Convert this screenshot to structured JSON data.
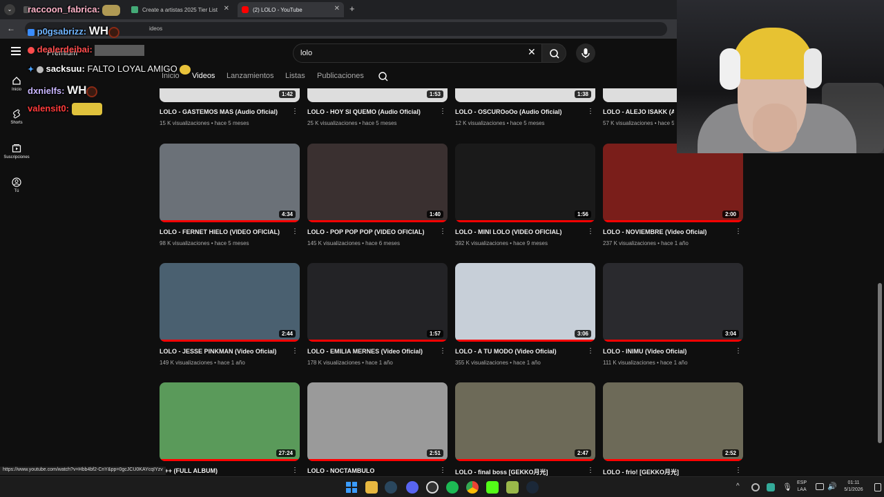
{
  "browser": {
    "tabs": [
      {
        "label": "",
        "color": "#555"
      },
      {
        "label": "Create a artistas 2025 Tier List",
        "color": "#4a7"
      },
      {
        "label": "(2) LOLO - YouTube",
        "color": "#f00"
      }
    ],
    "url_fragment": "ideos",
    "status_url": "https://www.youtube.com/watch?v=Hbb4bf2-CnY&pp=0gcJCU0KAYcqIYzv"
  },
  "youtube": {
    "search_value": "lolo",
    "premium_label": "Premium",
    "sidebar": [
      {
        "label": "Inicio"
      },
      {
        "label": "Shorts"
      },
      {
        "label": "Suscripciones"
      },
      {
        "label": "Tú"
      }
    ],
    "channel_tabs": [
      "Inicio",
      "Videos",
      "Lanzamientos",
      "Listas",
      "Publicaciones"
    ],
    "rows": [
      [
        {
          "title": "LOLO - GASTEMOS MAS (Audio Oficial)",
          "meta": "15 K visualizaciones • hace 5 meses",
          "dur": "1:42",
          "color": "#ddd"
        },
        {
          "title": "LOLO - HOY SI QUEMO (Audio Oficial)",
          "meta": "25 K visualizaciones • hace 5 meses",
          "dur": "1:53",
          "color": "#ddd"
        },
        {
          "title": "LOLO - OSCUROoOo (Audio Oficial)",
          "meta": "12 K visualizaciones • hace 5 meses",
          "dur": "1:38",
          "color": "#ddd"
        },
        {
          "title": "LOLO - ALEJO ISAKK (Au",
          "meta": "57 K visualizaciones • hace 5",
          "dur": "",
          "color": "#ddd"
        }
      ],
      [
        {
          "title": "LOLO - FERNET HIELO (VIDEO OFICIAL)",
          "meta": "98 K visualizaciones • hace 5 meses",
          "dur": "4:34",
          "color": "#6b7178"
        },
        {
          "title": "LOLO - POP POP POP (VIDEO OFICIAL)",
          "meta": "145 K visualizaciones • hace 6 meses",
          "dur": "1:40",
          "color": "#3a3030"
        },
        {
          "title": "LOLO - MINI LOLO (VIDEO OFICIAL)",
          "meta": "392 K visualizaciones • hace 9 meses",
          "dur": "1:56",
          "color": "#1a1a1a"
        },
        {
          "title": "LOLO - NOVIEMBRE (Video Oficial)",
          "meta": "237 K visualizaciones • hace 1 año",
          "dur": "2:00",
          "color": "#7a1e1a"
        }
      ],
      [
        {
          "title": "LOLO - JESSE PINKMAN (Video Oficial)",
          "meta": "149 K visualizaciones • hace 1 año",
          "dur": "2:44",
          "color": "#4a6070"
        },
        {
          "title": "LOLO - EMILIA MERNES (Video Oficial)",
          "meta": "178 K visualizaciones • hace 1 año",
          "dur": "1:57",
          "color": "#232326"
        },
        {
          "title": "LOLO - A TU MODO (Video Oficial)",
          "meta": "355 K visualizaciones • hace 1 año",
          "dur": "3:06",
          "color": "#c7cfd8"
        },
        {
          "title": "LOLO - INIMU (Video Oficial)",
          "meta": "111 K visualizaciones • hace 1 año",
          "dur": "3:04",
          "color": "#2a2a2e"
        }
      ],
      [
        {
          "title": "4 ++ (FULL ALBUM)",
          "meta": "",
          "dur": "27:24",
          "color": "#5a9a5a"
        },
        {
          "title": "LOLO - NOCTAMBULO",
          "meta": "",
          "dur": "2:51",
          "color": "#9a9a9a"
        },
        {
          "title": "LOLO - final boss [GEKKO月光]",
          "meta": "",
          "dur": "2:47",
          "color": "#6d6a58"
        },
        {
          "title": "LOLO - frio! [GEKKO月光]",
          "meta": "",
          "dur": "2:52",
          "color": "#6d6a58"
        }
      ]
    ]
  },
  "chat": [
    {
      "user": "raccoon_fabrica:",
      "msg": "",
      "color": "#ffb3c8"
    },
    {
      "user": "p0gsabrizz:",
      "msg": "WH",
      "color": "#6fb5ff"
    },
    {
      "user": "dealerdeibai:",
      "msg": "",
      "color": "#ff4d4d"
    },
    {
      "user": "sacksuu:",
      "msg": "FALTO LOYAL AMIGO",
      "color": "#ffffff"
    },
    {
      "user": "dxnielfs:",
      "msg": "WH",
      "color": "#c9b6ff"
    },
    {
      "user": "valensit0:",
      "msg": "",
      "color": "#ff3b3b"
    }
  ],
  "taskbar": {
    "lang": "ESP",
    "lang2": "LAA",
    "time": "01:11",
    "date": "5/1/2026"
  }
}
